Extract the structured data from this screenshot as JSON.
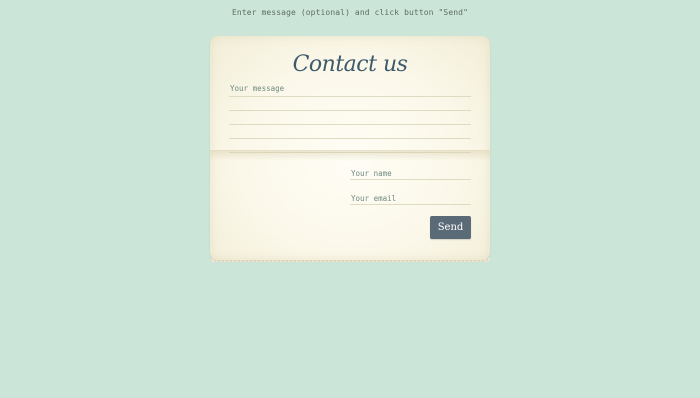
{
  "instruction": "Enter message (optional) and click button \"Send\"",
  "form": {
    "title": "Contact us",
    "message_placeholder": "Your message",
    "name_placeholder": "Your name",
    "email_placeholder": "Your email",
    "send_label": "Send"
  },
  "colors": {
    "background": "#cbe6d8",
    "card": "#fbf8ea",
    "title": "#3e5a6b",
    "button": "#5b6a77"
  }
}
